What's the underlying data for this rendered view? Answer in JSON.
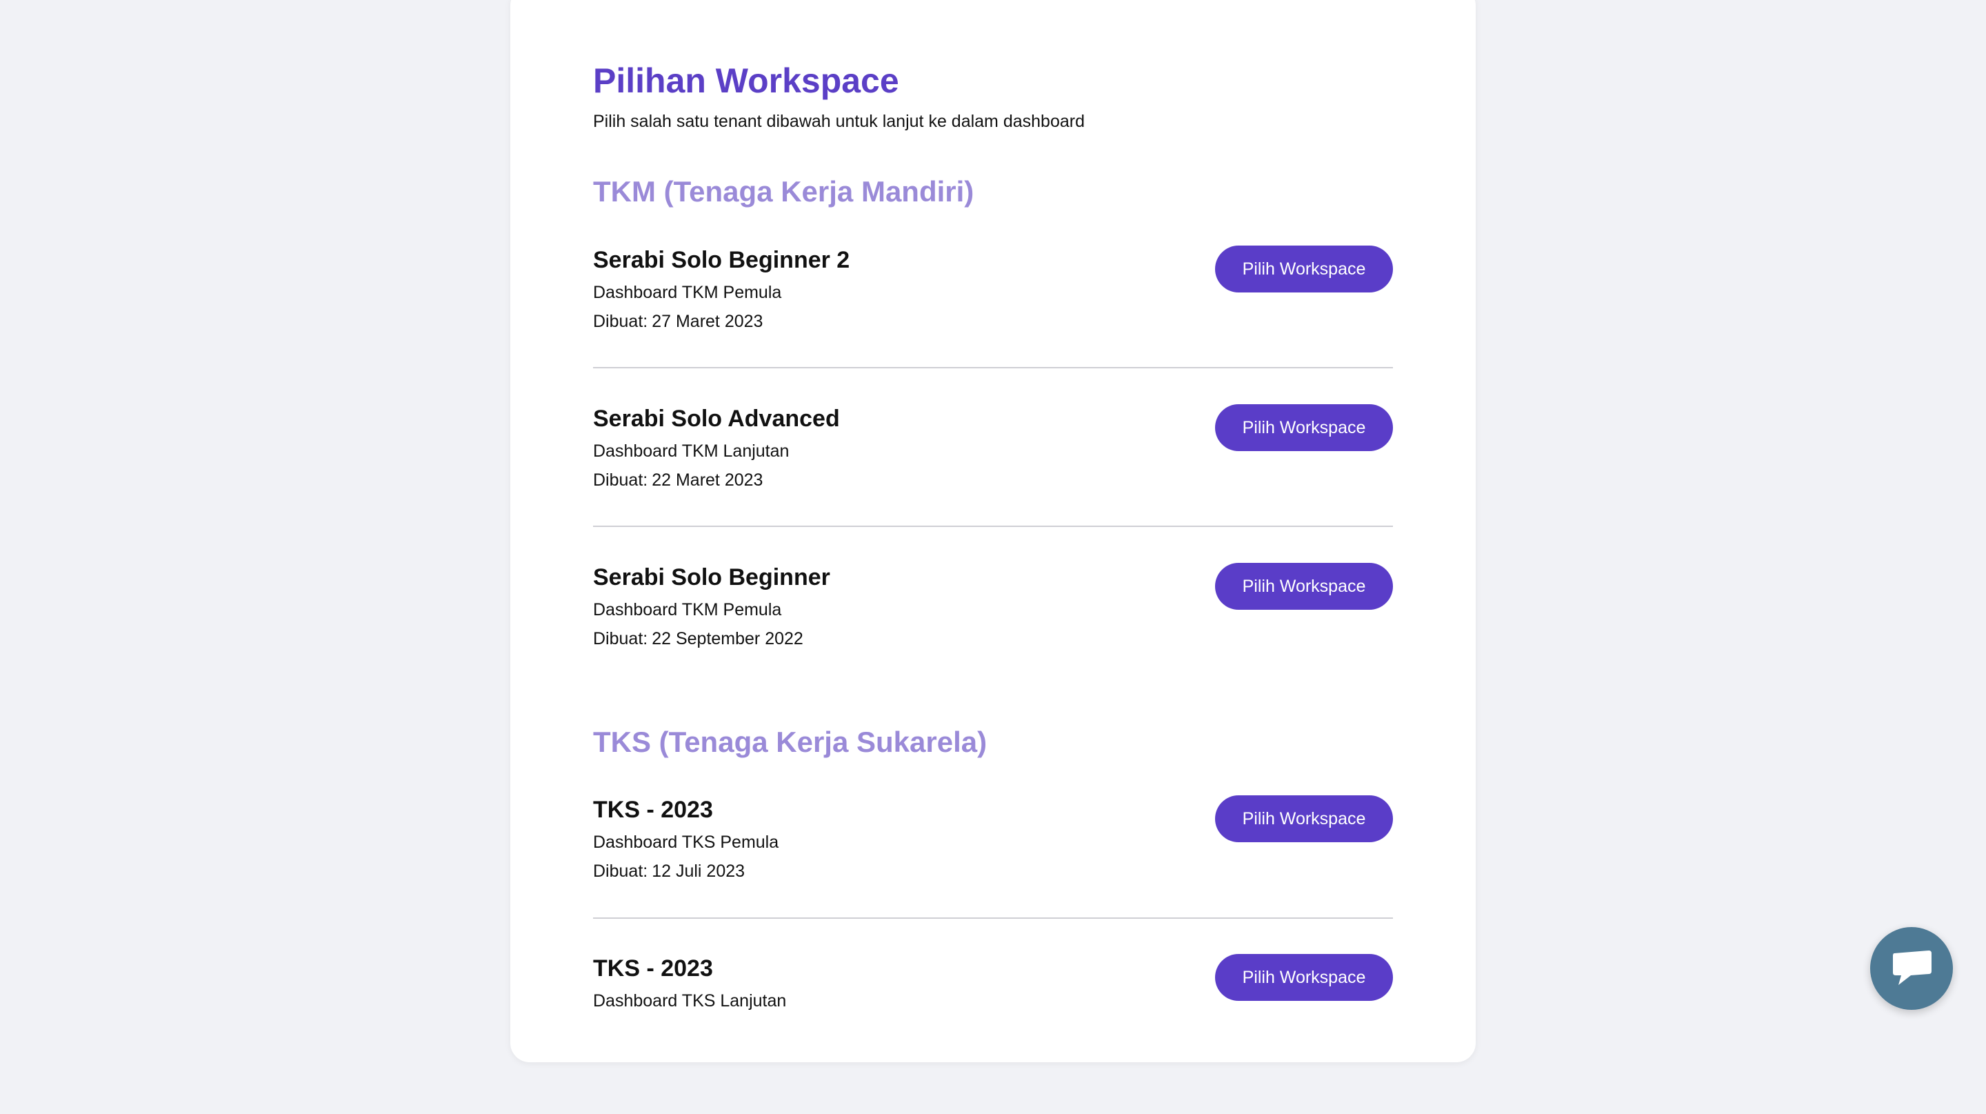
{
  "page": {
    "title": "Pilihan Workspace",
    "subtitle": "Pilih salah satu tenant dibawah untuk lanjut ke dalam dashboard"
  },
  "sections": [
    {
      "title": "TKM (Tenaga Kerja Mandiri)",
      "workspaces": [
        {
          "name": "Serabi Solo Beginner 2",
          "dashboard": "Dashboard TKM Pemula",
          "created_label": "Dibuat:",
          "created": "27 Maret 2023",
          "button": "Pilih Workspace"
        },
        {
          "name": "Serabi Solo Advanced",
          "dashboard": "Dashboard TKM Lanjutan",
          "created_label": "Dibuat:",
          "created": "22 Maret 2023",
          "button": "Pilih Workspace"
        },
        {
          "name": "Serabi Solo Beginner",
          "dashboard": "Dashboard TKM Pemula",
          "created_label": "Dibuat:",
          "created": "22 September 2022",
          "button": "Pilih Workspace"
        }
      ]
    },
    {
      "title": "TKS (Tenaga Kerja Sukarela)",
      "workspaces": [
        {
          "name": "TKS - 2023",
          "dashboard": "Dashboard TKS Pemula",
          "created_label": "Dibuat:",
          "created": "12 Juli 2023",
          "button": "Pilih Workspace"
        },
        {
          "name": "TKS - 2023",
          "dashboard": "Dashboard TKS Lanjutan",
          "button": "Pilih Workspace"
        }
      ]
    }
  ],
  "chat": {
    "icon": "chat-bubble-icon"
  },
  "colors": {
    "primary": "#5a3dc8",
    "title": "#5b3fc6",
    "section_title": "#9a8ad8",
    "background": "#f1f2f6",
    "chat_button": "#4e7a95"
  }
}
